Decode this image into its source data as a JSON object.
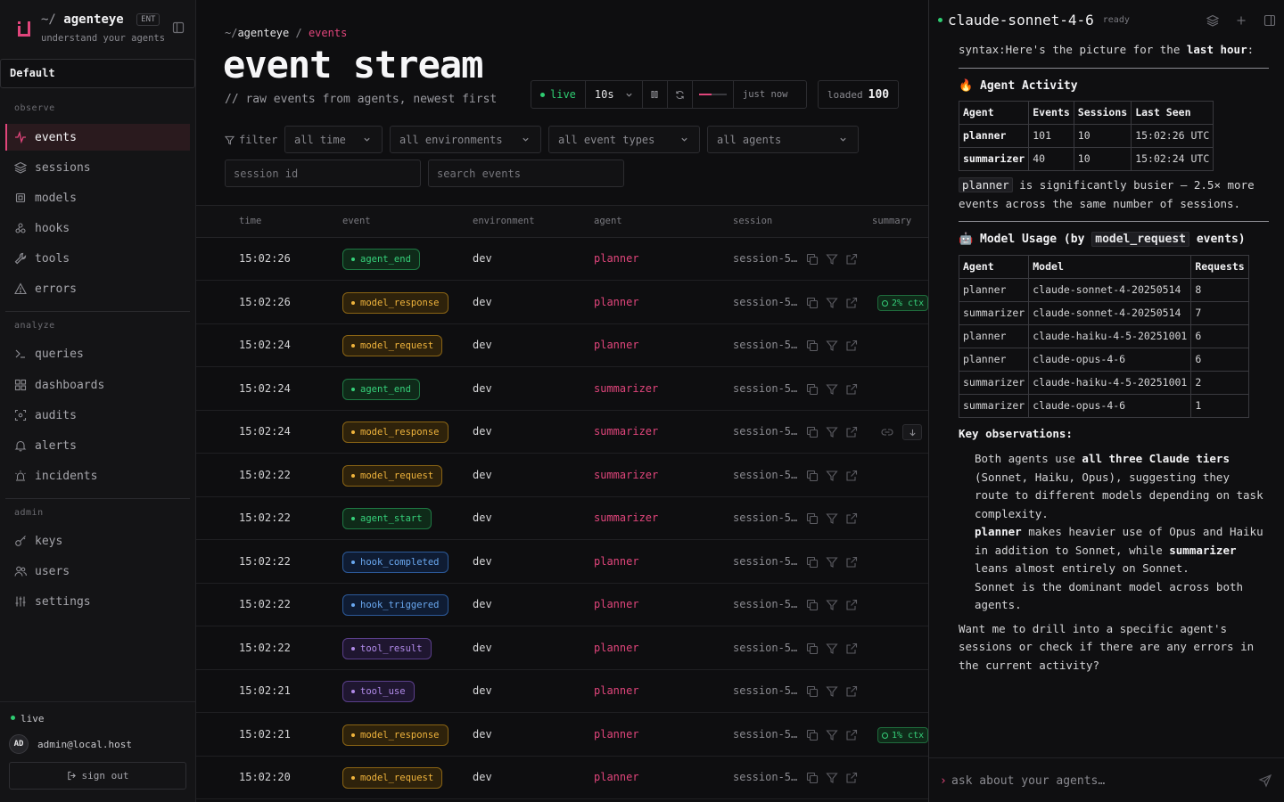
{
  "sidebar": {
    "brand_path": "~/",
    "brand_name": "agenteye",
    "brand_badge": "ENT",
    "brand_sub": "understand your agents",
    "workspace": "Default",
    "groups": [
      {
        "label": "observe"
      },
      {
        "label": "analyze"
      },
      {
        "label": "admin"
      }
    ],
    "items": [
      {
        "label": "events"
      },
      {
        "label": "sessions"
      },
      {
        "label": "models"
      },
      {
        "label": "hooks"
      },
      {
        "label": "tools"
      },
      {
        "label": "errors"
      },
      {
        "label": "queries"
      },
      {
        "label": "dashboards"
      },
      {
        "label": "audits"
      },
      {
        "label": "alerts"
      },
      {
        "label": "incidents"
      },
      {
        "label": "keys"
      },
      {
        "label": "users"
      },
      {
        "label": "settings"
      }
    ],
    "status": "live",
    "avatar": "AD",
    "user_email": "admin@local.host",
    "signout": "sign out"
  },
  "main": {
    "breadcrumb": {
      "root": "~/",
      "app": "agenteye",
      "sep": "/",
      "current": "events"
    },
    "title": "event stream",
    "subtitle": "// raw events from agents, newest first",
    "live_label": "live",
    "interval": "10s",
    "refresh_progress": 0.45,
    "updated": "just now",
    "loaded_label": "loaded",
    "loaded_count": "100",
    "filter_label": "filter",
    "filters": {
      "time": "all time",
      "env": "all environments",
      "types": "all event types",
      "agents": "all agents"
    },
    "session_placeholder": "session id",
    "search_placeholder": "search events",
    "columns": {
      "time": "time",
      "event": "event",
      "env": "environment",
      "agent": "agent",
      "session": "session",
      "summary": "summary"
    },
    "rows": [
      {
        "time": "15:02:26",
        "event": "agent_end",
        "env": "dev",
        "agent": "planner",
        "session": "session-5…"
      },
      {
        "time": "15:02:26",
        "event": "model_response",
        "env": "dev",
        "agent": "planner",
        "session": "session-5…",
        "ctx": "2% ctx"
      },
      {
        "time": "15:02:24",
        "event": "model_request",
        "env": "dev",
        "agent": "planner",
        "session": "session-5…"
      },
      {
        "time": "15:02:24",
        "event": "agent_end",
        "env": "dev",
        "agent": "summarizer",
        "session": "session-5…"
      },
      {
        "time": "15:02:24",
        "event": "model_response",
        "env": "dev",
        "agent": "summarizer",
        "session": "session-5…"
      },
      {
        "time": "15:02:22",
        "event": "model_request",
        "env": "dev",
        "agent": "summarizer",
        "session": "session-5…"
      },
      {
        "time": "15:02:22",
        "event": "agent_start",
        "env": "dev",
        "agent": "summarizer",
        "session": "session-5…"
      },
      {
        "time": "15:02:22",
        "event": "hook_completed",
        "env": "dev",
        "agent": "planner",
        "session": "session-5…"
      },
      {
        "time": "15:02:22",
        "event": "hook_triggered",
        "env": "dev",
        "agent": "planner",
        "session": "session-5…"
      },
      {
        "time": "15:02:22",
        "event": "tool_result",
        "env": "dev",
        "agent": "planner",
        "session": "session-5…"
      },
      {
        "time": "15:02:21",
        "event": "tool_use",
        "env": "dev",
        "agent": "planner",
        "session": "session-5…"
      },
      {
        "time": "15:02:21",
        "event": "model_response",
        "env": "dev",
        "agent": "planner",
        "session": "session-5…",
        "ctx": "1% ctx"
      },
      {
        "time": "15:02:20",
        "event": "model_request",
        "env": "dev",
        "agent": "planner",
        "session": "session-5…"
      }
    ]
  },
  "event_colors": {
    "agent_end": {
      "bg": "#0f2a19",
      "border": "#1f7a44",
      "fg": "#36d07a"
    },
    "agent_start": {
      "bg": "#0f2a19",
      "border": "#1f7a44",
      "fg": "#36d07a"
    },
    "model_response": {
      "bg": "#2e220b",
      "border": "#8a6414",
      "fg": "#f0b43c"
    },
    "model_request": {
      "bg": "#2e220b",
      "border": "#8a6414",
      "fg": "#f0b43c"
    },
    "hook_completed": {
      "bg": "#0f1c33",
      "border": "#2c5a9a",
      "fg": "#6aa8f0"
    },
    "hook_triggered": {
      "bg": "#0f1c33",
      "border": "#2c5a9a",
      "fg": "#6aa8f0"
    },
    "tool_result": {
      "bg": "#1f1630",
      "border": "#5a3f8a",
      "fg": "#b08ae8"
    },
    "tool_use": {
      "bg": "#1f1630",
      "border": "#5a3f8a",
      "fg": "#b08ae8"
    }
  },
  "chat": {
    "model": "claude-sonnet-4-6",
    "status": "ready",
    "intro_pre": "syntax:Here's the picture for the ",
    "intro_bold": "last hour",
    "intro_post": ":",
    "section1_icon": "🔥",
    "section1_title": "Agent Activity",
    "activity_headers": [
      "Agent",
      "Events",
      "Sessions",
      "Last Seen"
    ],
    "activity_rows": [
      [
        "planner",
        "101",
        "10",
        "15:02:26 UTC"
      ],
      [
        "summarizer",
        "40",
        "10",
        "15:02:24 UTC"
      ]
    ],
    "busier_code": "planner",
    "busier_text": " is significantly busier — 2.5× more events across the same number of sessions.",
    "section2_icon": "🤖",
    "section2_title_pre": "Model Usage (by ",
    "section2_title_code": "model_request",
    "section2_title_post": " events)",
    "usage_headers": [
      "Agent",
      "Model",
      "Requests"
    ],
    "usage_rows": [
      [
        "planner",
        "claude-sonnet-4-20250514",
        "8"
      ],
      [
        "summarizer",
        "claude-sonnet-4-20250514",
        "7"
      ],
      [
        "planner",
        "claude-haiku-4-5-20251001",
        "6"
      ],
      [
        "planner",
        "claude-opus-4-6",
        "6"
      ],
      [
        "summarizer",
        "claude-haiku-4-5-20251001",
        "2"
      ],
      [
        "summarizer",
        "claude-opus-4-6",
        "1"
      ]
    ],
    "obs_title": "Key observations:",
    "obs1_pre": "Both agents use ",
    "obs1_bold": "all three Claude tiers",
    "obs1_post": " (Sonnet, Haiku, Opus), suggesting they route to different models depending on task complexity.",
    "obs2_b1": "planner",
    "obs2_mid": " makes heavier use of Opus and Haiku in addition to Sonnet, while ",
    "obs2_b2": "summarizer",
    "obs2_post": " leans almost entirely on Sonnet.",
    "obs3": "Sonnet is the dominant model across both agents.",
    "closing": "Want me to drill into a specific agent's sessions or check if there are any errors in the current activity?",
    "input_placeholder": "ask about your agents…"
  }
}
